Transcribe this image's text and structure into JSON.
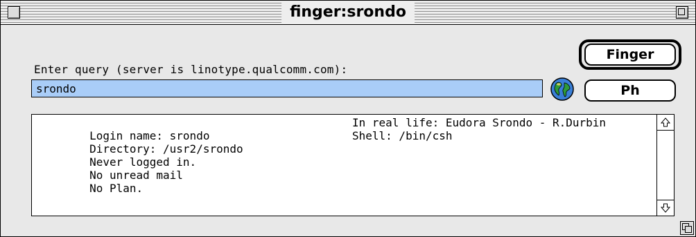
{
  "window": {
    "title": "finger:srondo"
  },
  "query": {
    "label": "Enter query (server is linotype.qualcomm.com):",
    "value": "srondo"
  },
  "buttons": {
    "finger": "Finger",
    "ph": "Ph"
  },
  "results": {
    "lines": [
      {
        "left": "Login name: srondo",
        "right": "In real life: Eudora Srondo - R.Durbin"
      },
      {
        "left": "Directory: /usr2/srondo",
        "right": "Shell: /bin/csh"
      },
      {
        "left": "Never logged in.",
        "right": ""
      },
      {
        "left": "No unread mail",
        "right": ""
      },
      {
        "left": "No Plan.",
        "right": ""
      }
    ]
  },
  "icons": {
    "globe": "globe-icon",
    "close": "close-box-icon",
    "zoom": "zoom-box-icon",
    "scroll_up": "scroll-up-arrow-icon",
    "scroll_down": "scroll-down-arrow-icon",
    "grow": "grow-box-icon"
  },
  "colors": {
    "input_highlight": "#a9cdf8",
    "window_bg": "#e8e8e8"
  }
}
